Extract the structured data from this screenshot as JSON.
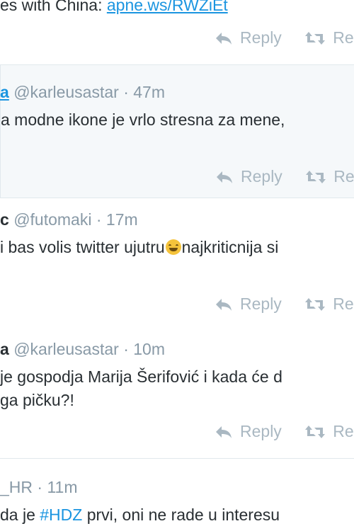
{
  "tweets": [
    {
      "text_pre": "es with China: ",
      "link": "apne.ws/RWZiEt",
      "reply_label": "Reply",
      "retweet_label": "Re"
    },
    {
      "name": "a",
      "handle": "@karleusastar",
      "time": "47m",
      "text": "a modne ikone je vrlo stresna za mene,",
      "reply_label": "Reply",
      "retweet_label": "Re"
    },
    {
      "name": "c",
      "handle": "@futomaki",
      "time": "17m",
      "text_pre": "i bas volis twitter ujutru",
      "text_post": "najkriticnija si",
      "emoji": "grinning-face-emoji",
      "reply_label": "Reply",
      "retweet_label": "Re"
    },
    {
      "name": "a",
      "handle": "@karleusastar",
      "time": "10m",
      "line1": "je gospodja Marija Šerifović i kada će d",
      "line2": "ga pičku?!",
      "reply_label": "Reply",
      "retweet_label": "Re"
    },
    {
      "handle": "_HR",
      "time": "11m",
      "text_pre": "da je ",
      "hashtag": "#HDZ",
      "text_post": " prvi, oni ne rade u interesu"
    }
  ],
  "separator": "·",
  "colors": {
    "link": "#1b95e0",
    "muted": "#8899a6",
    "icon": "#aab8c2",
    "highlight_bg": "#f5f8fa"
  }
}
